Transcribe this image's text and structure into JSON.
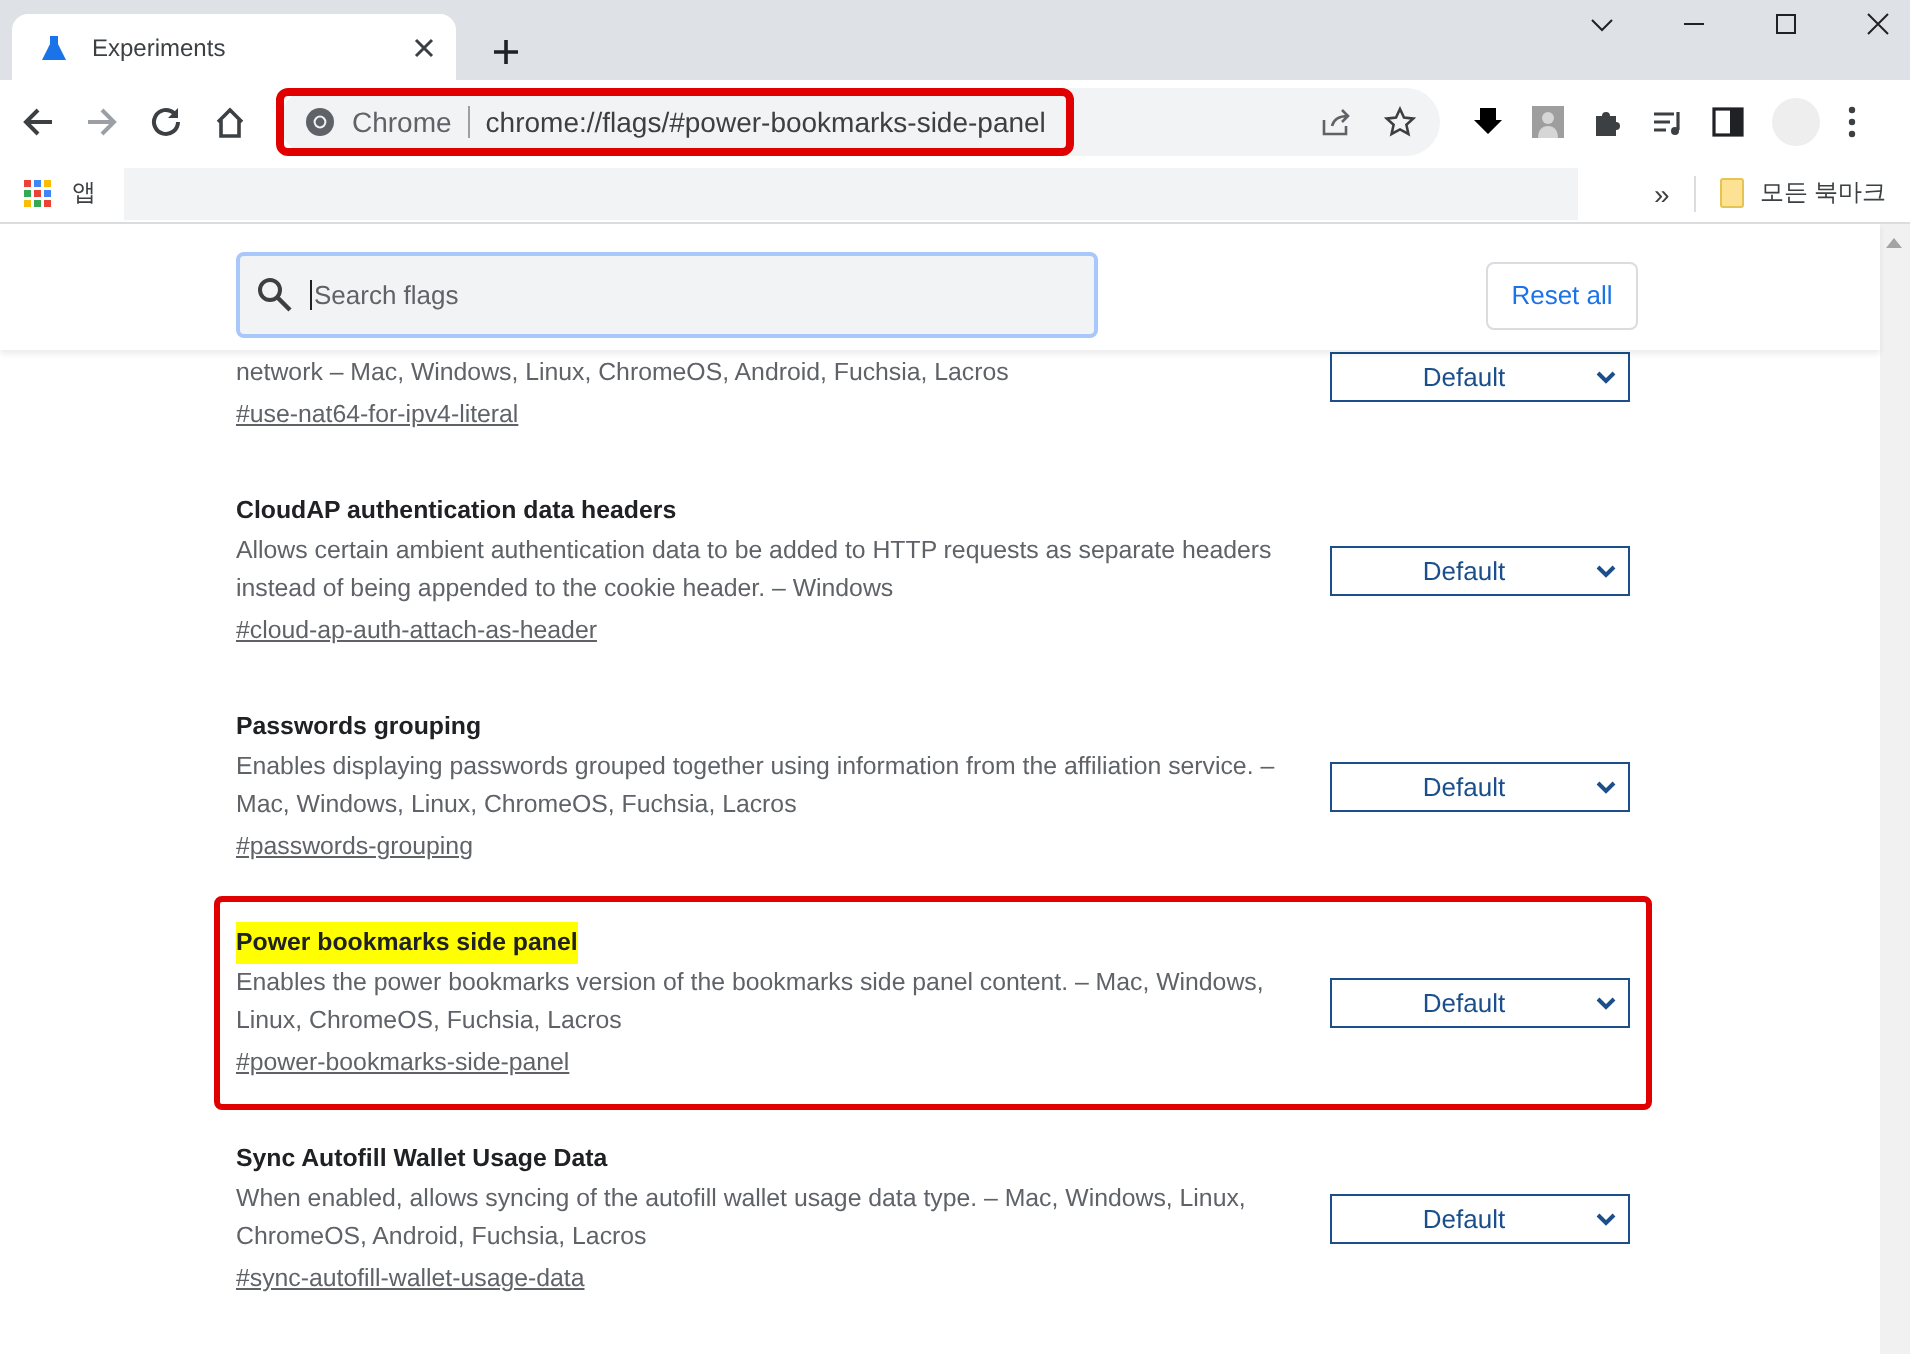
{
  "tab": {
    "title": "Experiments",
    "selected": true
  },
  "omnibox": {
    "site_label": "Chrome",
    "url": "chrome://flags/#power-bookmarks-side-panel",
    "annotated": true
  },
  "bookmarks_bar": {
    "apps_label": "앱",
    "overflow": "»",
    "folder": "모든 북마크"
  },
  "search": {
    "placeholder": "Search flags",
    "focused": true
  },
  "reset_button": "Reset all",
  "flags": [
    {
      "description": "network – Mac, Windows, Linux, ChromeOS, Android, Fuchsia, Lacros",
      "link": "#use-nat64-for-ipv4-literal",
      "value": "Default",
      "annotated": false
    },
    {
      "title": "CloudAP authentication data headers",
      "description": "Allows certain ambient authentication data to be added to HTTP requests as separate headers instead of being appended to the cookie header. – Windows",
      "link": "#cloud-ap-auth-attach-as-header",
      "value": "Default",
      "annotated": false,
      "highlighted": false
    },
    {
      "title": "Passwords grouping",
      "description": "Enables displaying passwords grouped together using information from the affiliation service. – Mac, Windows, Linux, ChromeOS, Fuchsia, Lacros",
      "link": "#passwords-grouping",
      "value": "Default",
      "annotated": false,
      "highlighted": false
    },
    {
      "title": "Power bookmarks side panel",
      "description": "Enables the power bookmarks version of the bookmarks side panel content. – Mac, Windows, Linux, ChromeOS, Fuchsia, Lacros",
      "link": "#power-bookmarks-side-panel",
      "value": "Default",
      "annotated": true,
      "highlighted": true
    },
    {
      "title": "Sync Autofill Wallet Usage Data",
      "description": "When enabled, allows syncing of the autofill wallet usage data type. – Mac, Windows, Linux, ChromeOS, Android, Fuchsia, Lacros",
      "link": "#sync-autofill-wallet-usage-data",
      "value": "Default",
      "annotated": false,
      "highlighted": false
    }
  ]
}
